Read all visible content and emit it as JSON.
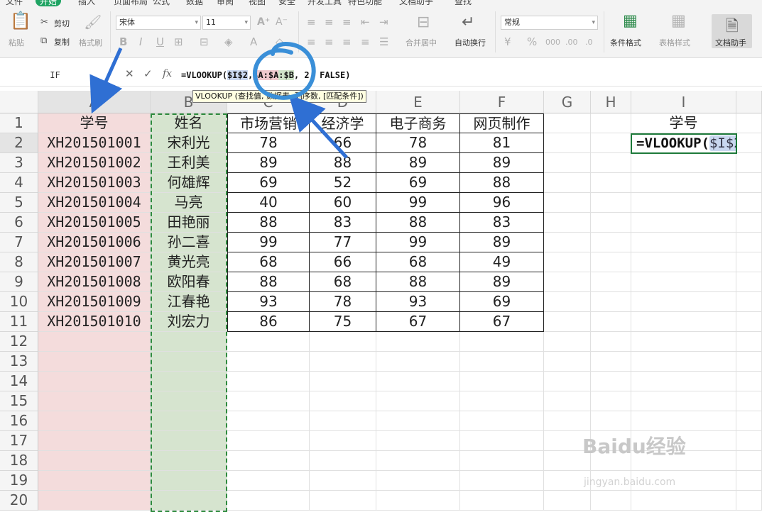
{
  "menubar": {
    "items": [
      "文件",
      "开始",
      "插入",
      "页面布局",
      "公式",
      "数据",
      "审阅",
      "视图",
      "安全",
      "开发工具",
      "特色功能",
      "文档助手",
      "查找"
    ],
    "active": "开始"
  },
  "ribbon": {
    "paste": "粘贴",
    "cut": "剪切",
    "copy": "复制",
    "format_painter": "格式刷",
    "font_name": "宋体",
    "font_size": "11",
    "merge_center": "合并居中",
    "auto_wrap": "自动换行",
    "number_format": "常规",
    "conditional_format": "条件格式",
    "table_style": "表格样式",
    "doc_assistant": "文档助手"
  },
  "formula_bar": {
    "name_box": "IF",
    "fx": "fx",
    "formula_prefix": "=VLOOKUP(",
    "ref_i": "$I$2",
    "sep1": ",",
    "ref_a": "$A:$A",
    "ref_b": ":$B",
    "formula_suffix": ", 2, FALSE)"
  },
  "tooltip": "VLOOKUP (查找值, 数据表, 列序数, [匹配条件])",
  "columns": [
    "A",
    "B",
    "C",
    "D",
    "E",
    "F",
    "G",
    "H",
    "I"
  ],
  "headers": {
    "A": "学号",
    "B": "姓名",
    "C": "市场营销",
    "D": "经济学",
    "E": "电子商务",
    "F": "网页制作",
    "I": "学号"
  },
  "rows": [
    {
      "id": "XH201501001",
      "name": "宋利光",
      "c": "78",
      "d": "66",
      "e": "78",
      "f": "81"
    },
    {
      "id": "XH201501002",
      "name": "王利美",
      "c": "89",
      "d": "88",
      "e": "89",
      "f": "89"
    },
    {
      "id": "XH201501003",
      "name": "何雄辉",
      "c": "69",
      "d": "52",
      "e": "69",
      "f": "88"
    },
    {
      "id": "XH201501004",
      "name": "马亮",
      "c": "40",
      "d": "60",
      "e": "99",
      "f": "96"
    },
    {
      "id": "XH201501005",
      "name": "田艳丽",
      "c": "88",
      "d": "83",
      "e": "88",
      "f": "83"
    },
    {
      "id": "XH201501006",
      "name": "孙二喜",
      "c": "99",
      "d": "77",
      "e": "99",
      "f": "89"
    },
    {
      "id": "XH201501007",
      "name": "黄光亮",
      "c": "68",
      "d": "66",
      "e": "68",
      "f": "49"
    },
    {
      "id": "XH201501008",
      "name": "欧阳春",
      "c": "88",
      "d": "68",
      "e": "88",
      "f": "89"
    },
    {
      "id": "XH201501009",
      "name": "江春艳",
      "c": "93",
      "d": "78",
      "e": "93",
      "f": "69"
    },
    {
      "id": "XH201501010",
      "name": "刘宏力",
      "c": "86",
      "d": "75",
      "e": "67",
      "f": "67"
    }
  ],
  "row_numbers": [
    "1",
    "2",
    "3",
    "4",
    "5",
    "6",
    "7",
    "8",
    "9",
    "10",
    "11",
    "12",
    "13",
    "14",
    "15",
    "16",
    "17",
    "18",
    "19",
    "20"
  ],
  "active_cell": {
    "prefix": "=VLOOKUP(",
    "ref": "$I$2"
  },
  "colors": {
    "col_a_fill": "#f4dcdc",
    "col_b_fill": "#d6e4cf",
    "annotation_blue": "#2f7fd3",
    "selection_green": "#1d7a3a"
  },
  "watermark": {
    "main": "Baidu经验",
    "sub": "jingyan.baidu.com"
  }
}
